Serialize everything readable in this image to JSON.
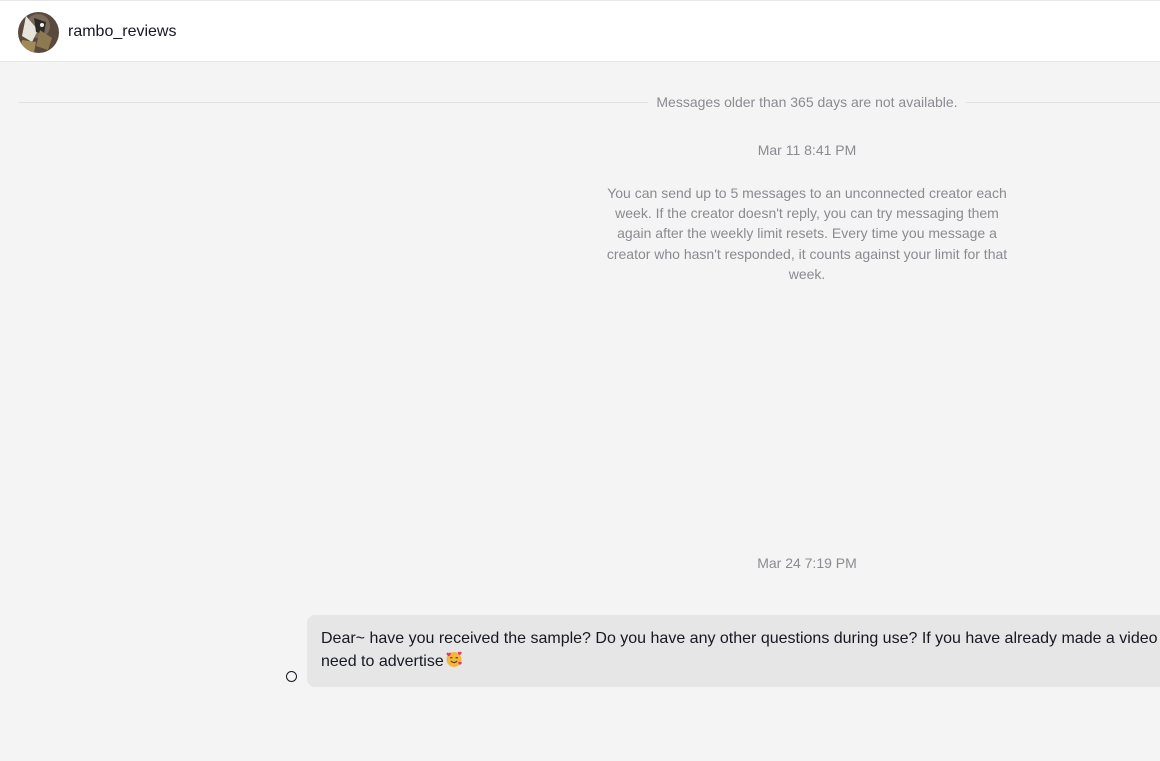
{
  "header": {
    "username": "rambo_reviews",
    "avatar_icon": "profile-photo"
  },
  "conversation": {
    "history_notice": "Messages older than 365 days are not available.",
    "timestamps": [
      "Mar 11 8:41 PM",
      "Mar 24 7:19 PM"
    ],
    "limit_notice": "You can send up to 5 messages to an unconnected creator each week. If the creator doesn't reply, you can try messaging them again after the weekly limit resets. Every time you message a creator who hasn't responded, it counts against your limit for that week.",
    "messages": [
      {
        "line1": "Dear~ have you received the sample? Do you have any other questions during use? If you have already made a video",
        "line2": "need to advertise",
        "emoji_icon": "smiling-face-with-hearts-icon",
        "status_icon": "message-status-circle-icon"
      }
    ]
  },
  "colors": {
    "background": "#f4f4f4",
    "header_background": "#ffffff",
    "bubble_background": "#e6e6e6",
    "secondary_text": "#8a8b91",
    "primary_text": "#161823"
  }
}
